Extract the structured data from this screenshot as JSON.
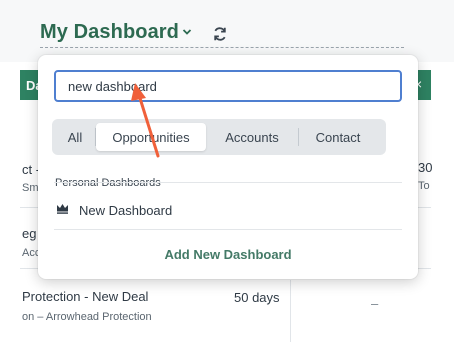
{
  "header": {
    "title": "My Dashboard"
  },
  "background": {
    "band_text": "Da",
    "band_close": "×",
    "rows": [
      {
        "main": "ct -",
        "sub": "Sma",
        "right_main": "30",
        "right_sub": "To"
      },
      {
        "main": "eg",
        "sub": "Acc"
      },
      {
        "main": "Protection - New Deal",
        "sub": "on – Arrowhead Protection",
        "duration": "50 days",
        "dash": "–"
      }
    ]
  },
  "popover": {
    "search_value": "new dashboard",
    "tabs": [
      {
        "label": "All",
        "active": false
      },
      {
        "label": "Opportunities",
        "active": true
      },
      {
        "label": "Accounts",
        "active": false
      },
      {
        "label": "Contact",
        "active": false
      }
    ],
    "section_label": "Personal Dashboards",
    "items": [
      {
        "label": "New Dashboard"
      }
    ],
    "add_label": "Add New Dashboard"
  },
  "colors": {
    "accent": "#2d6a51",
    "focus": "#4f7fd0",
    "arrow": "#f0603a"
  }
}
